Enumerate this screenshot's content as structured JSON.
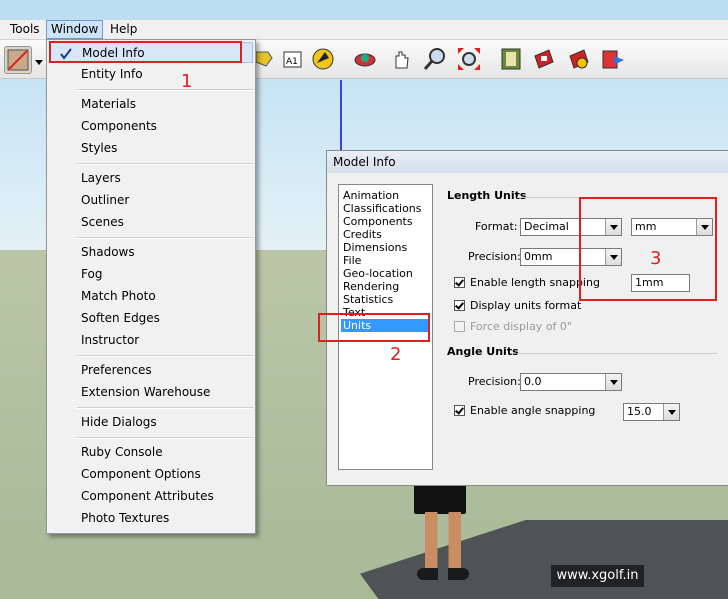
{
  "menubar": {
    "tools": "Tools",
    "window": "Window",
    "help": "Help"
  },
  "toolbar": {
    "icons": [
      "line-tool-icon",
      "dropdown-arrow-icon",
      "text-tool-icon",
      "dimension-tool-icon",
      "paint-bucket-icon",
      "orbit-icon",
      "pan-icon",
      "zoom-icon",
      "zoom-extents-icon",
      "model-book-icon",
      "section-icon",
      "components-icon",
      "export-icon"
    ]
  },
  "window_menu": {
    "items": [
      "Model Info",
      "Entity Info",
      "Materials",
      "Components",
      "Styles",
      "Layers",
      "Outliner",
      "Scenes",
      "Shadows",
      "Fog",
      "Match Photo",
      "Soften Edges",
      "Instructor",
      "Preferences",
      "Extension Warehouse",
      "Hide Dialogs",
      "Ruby Console",
      "Component Options",
      "Component Attributes",
      "Photo Textures"
    ]
  },
  "dialog": {
    "title": "Model Info",
    "categories": [
      "Animation",
      "Classifications",
      "Components",
      "Credits",
      "Dimensions",
      "File",
      "Geo-location",
      "Rendering",
      "Statistics",
      "Text",
      "Units"
    ],
    "selected_category": "Units",
    "length_units": {
      "heading": "Length Units",
      "format_label": "Format:",
      "format_value": "Decimal",
      "unit_value": "mm",
      "precision_label": "Precision:",
      "precision_value": "0mm",
      "snapping_label": "Enable length snapping",
      "snapping_value": "1mm",
      "display_format_label": "Display units format",
      "force_label": "Force display of 0\""
    },
    "angle_units": {
      "heading": "Angle Units",
      "precision_label": "Precision:",
      "precision_value": "0.0",
      "snapping_label": "Enable angle snapping",
      "snapping_value": "15.0"
    }
  },
  "annotations": {
    "step1": "1",
    "step2": "2",
    "step3": "3",
    "accent": "#e02020"
  },
  "watermark": "www.xgolf.in"
}
